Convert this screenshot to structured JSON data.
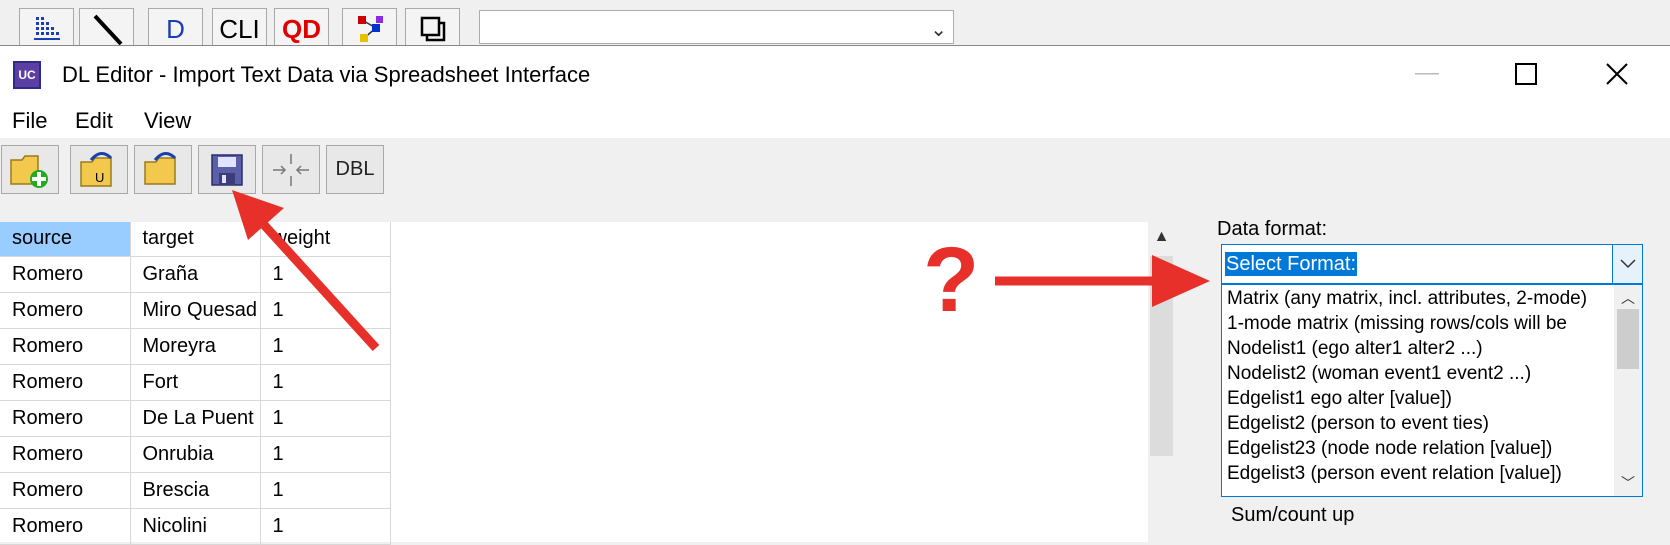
{
  "top_toolbar": {
    "buttons": [
      {
        "icon": "matrix-dots-icon"
      },
      {
        "icon": "pen-icon"
      },
      {
        "label": "D"
      },
      {
        "label": "CLI"
      },
      {
        "label": "QD"
      },
      {
        "icon": "network-graph-icon"
      },
      {
        "icon": "windows-icon"
      }
    ],
    "combo_value": ""
  },
  "window": {
    "title": "DL Editor - Import Text Data via Spreadsheet Interface",
    "icon_label": "UC",
    "menu": [
      "File",
      "Edit",
      "View"
    ]
  },
  "toolbar": {
    "buttons": [
      {
        "icon": "new-folder-icon"
      },
      {
        "icon": "open-ucinet-icon",
        "badge": "U"
      },
      {
        "icon": "open-folder-icon"
      },
      {
        "icon": "save-icon"
      },
      {
        "icon": "compress-icon"
      },
      {
        "label": "DBL"
      }
    ]
  },
  "grid": {
    "headers": [
      "source",
      "target",
      "weight"
    ],
    "rows": [
      [
        "Romero",
        "Graña",
        "1"
      ],
      [
        "Romero",
        "Miro Quesad",
        "1"
      ],
      [
        "Romero",
        "Moreyra",
        "1"
      ],
      [
        "Romero",
        "Fort",
        "1"
      ],
      [
        "Romero",
        "De La Puent",
        "1"
      ],
      [
        "Romero",
        "Onrubia",
        "1"
      ],
      [
        "Romero",
        "Brescia",
        "1"
      ],
      [
        "Romero",
        "Nicolini",
        "1"
      ]
    ]
  },
  "data_format": {
    "label": "Data format:",
    "selected": "Select Format:",
    "options": [
      "Matrix (any matrix, incl. attributes, 2-mode)",
      "1-mode matrix (missing rows/cols will be",
      "Nodelist1 (ego alter1 alter2 ...)",
      "Nodelist2 (woman event1 event2 ...)",
      "Edgelist1 ego alter [value])",
      "Edgelist2 (person to event ties)",
      "Edgelist23 (node node relation [value])",
      "Edgelist3 (person event relation [value])"
    ],
    "partial_radio": "Sum/count up"
  },
  "annotations": {
    "question_mark": "?",
    "arrow_color": "#e8302a"
  }
}
